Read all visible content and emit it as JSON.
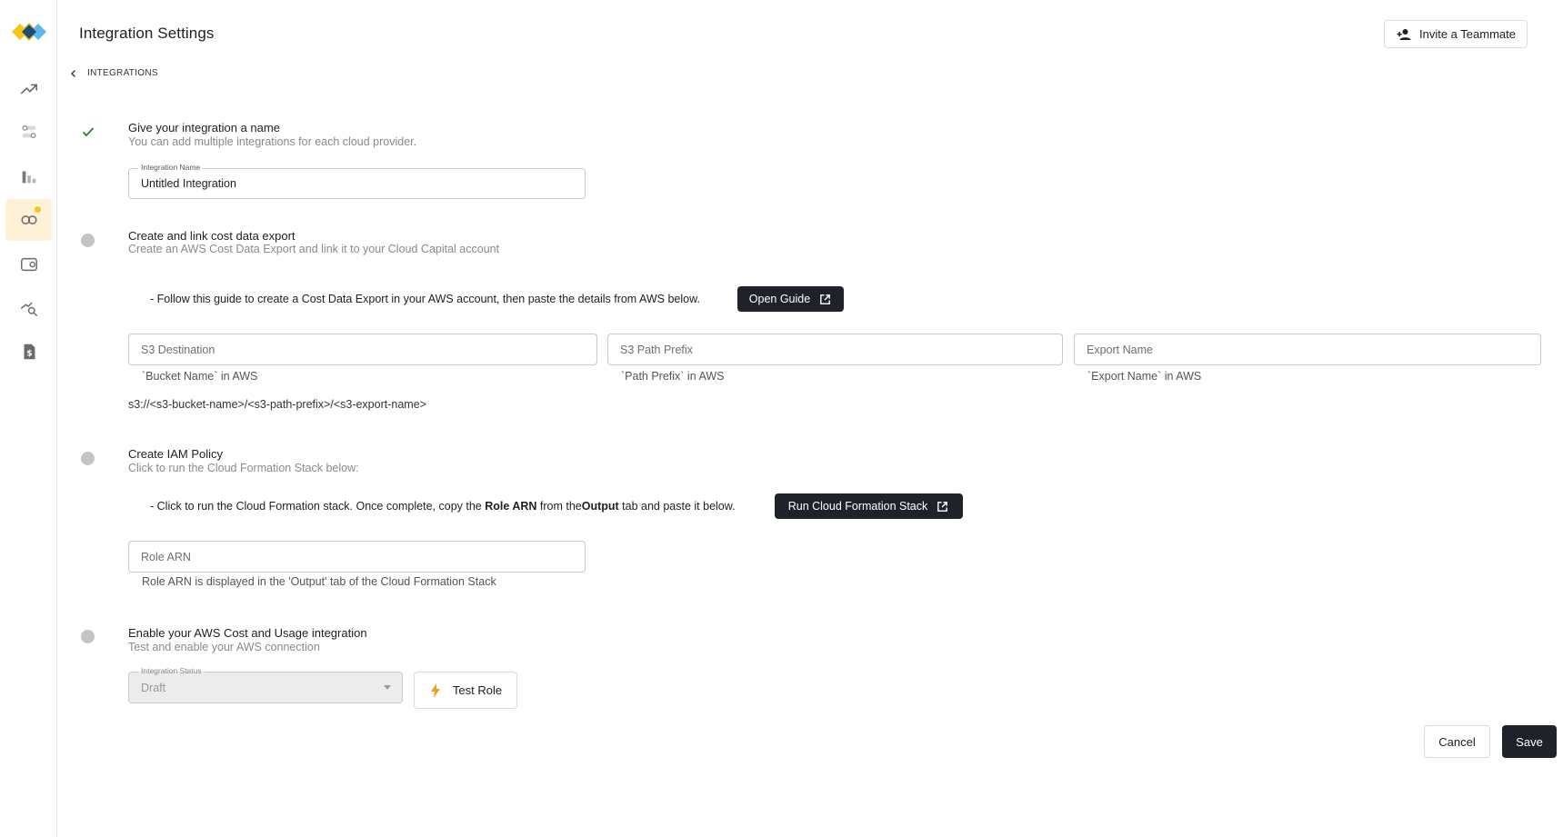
{
  "header": {
    "title": "Integration Settings",
    "invite_label": "Invite a Teammate"
  },
  "breadcrumb": {
    "label": "INTEGRATIONS"
  },
  "colors": {
    "accent_yellow": "#f5c518",
    "logo_blue": "#1f4e79",
    "dark_button": "#1f2329",
    "success_green": "#2e7d32",
    "step_pending": "#c4c4c4"
  },
  "sidebar": {
    "items": [
      {
        "icon": "trend-up-icon",
        "active": false
      },
      {
        "icon": "toggles-icon",
        "active": false
      },
      {
        "icon": "bar-chart-icon",
        "active": false
      },
      {
        "icon": "infinity-link-icon",
        "active": true
      },
      {
        "icon": "wallet-icon",
        "active": false
      },
      {
        "icon": "search-analytics-icon",
        "active": false
      },
      {
        "icon": "invoice-dollar-icon",
        "active": false
      }
    ]
  },
  "step1": {
    "status": "complete",
    "title": "Give your integration a name",
    "subtitle": "You can add multiple integrations for each cloud provider.",
    "name_label": "Integration Name",
    "name_value": "Untitled Integration"
  },
  "step2": {
    "status": "pending",
    "title": "Create and link cost data export",
    "subtitle": "Create an AWS Cost Data Export and link it to your Cloud Capital account",
    "guide_text": "- Follow this guide to create a Cost Data Export in your AWS account, then paste the details from AWS below.",
    "open_guide_label": "Open Guide",
    "s3_destination_placeholder": "S3 Destination",
    "s3_destination_helper": "`Bucket Name` in AWS",
    "s3_path_prefix_placeholder": "S3 Path Prefix",
    "s3_path_prefix_helper": "`Path Prefix` in AWS",
    "export_name_placeholder": "Export Name",
    "export_name_helper": "`Export Name` in AWS",
    "s3_path": "s3://<s3-bucket-name>/<s3-path-prefix>/<s3-export-name>"
  },
  "step3": {
    "status": "pending",
    "title": "Create IAM Policy",
    "subtitle": "Click to run the Cloud Formation Stack below:",
    "guide_part1": "- Click to run the Cloud Formation stack. Once complete, copy the ",
    "guide_bold1": "Role ARN",
    "guide_part2": " from the",
    "guide_bold2": "Output",
    "guide_part3": " tab and paste it below.",
    "run_stack_label": "Run Cloud Formation Stack",
    "role_arn_placeholder": "Role ARN",
    "role_arn_helper": "Role ARN is displayed in the 'Output' tab of the Cloud Formation Stack"
  },
  "step4": {
    "status": "pending",
    "title": "Enable your AWS Cost and Usage integration",
    "subtitle": "Test and enable your AWS connection",
    "status_label": "Integration Status",
    "status_value": "Draft",
    "test_role_label": "Test Role"
  },
  "footer": {
    "cancel_label": "Cancel",
    "save_label": "Save"
  }
}
